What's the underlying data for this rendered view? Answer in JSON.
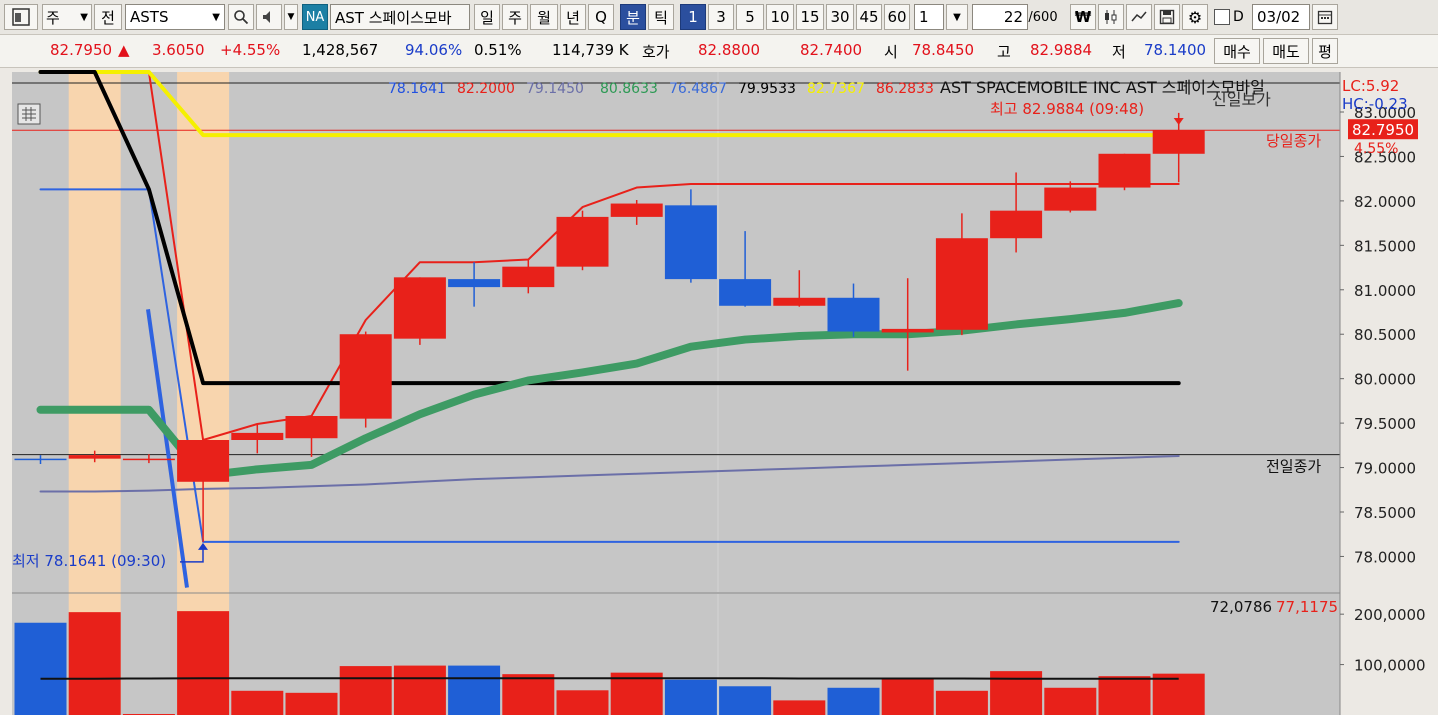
{
  "toolbar": {
    "type_label": "주",
    "prev_label": "전",
    "symbol": "ASTS",
    "badge": "NA",
    "name": "AST 스페이스모바",
    "periods": [
      "일",
      "주",
      "월",
      "년",
      "Q",
      "분",
      "틱"
    ],
    "minutes": [
      "1",
      "3",
      "5",
      "10",
      "15",
      "30",
      "45",
      "60"
    ],
    "step_value": "1",
    "count_value": "22",
    "count_total": "/600",
    "date_check_label": "D",
    "date_value": "03/02"
  },
  "quote": {
    "price": "82.7950",
    "arrow": "▲",
    "change": "3.6050",
    "change_pct": "+4.55%",
    "volume": "1,428,567",
    "vol_ratio": "94.06%",
    "turnover_pct": "0.51%",
    "amount": "114,739 K",
    "hoga_label": "호가",
    "ask": "82.8800",
    "bid": "82.7400",
    "open_label": "시",
    "open": "78.8450",
    "high_label": "고",
    "high": "82.9884",
    "low_label": "저",
    "low": "78.1400",
    "buy_label": "매수",
    "sell_label": "매도",
    "flat_label": "평"
  },
  "colors": {
    "up": "#e8211a",
    "down": "#1f5fd6",
    "ma_green": "#3e9b64",
    "ma_yellow": "#f5f000",
    "plot_bg": "#c6c6c6",
    "highlight": "#f8d5ae"
  },
  "chart_data": {
    "type": "candlestick",
    "legend": {
      "values": [
        "78.1641",
        "82.2000",
        "79.1450",
        "80.8633",
        "76.4867",
        "79.9533",
        "82.7367",
        "86.2833"
      ],
      "colors": [
        "#2151e0",
        "#e8211a",
        "#6b6fa8",
        "#2e9a55",
        "#3a6ad8",
        "#000000",
        "#f5f000",
        "#e8211a"
      ],
      "title": "AST SPACEMOBILE INC  AST 스페이스모바일"
    },
    "lc_label": "LC:5.92",
    "hc_label": "HC:-0.23",
    "price_tag": "82.7950",
    "price_tag_pct": "4.55%",
    "high_annotation": "최고 82.9884 (09:48)",
    "low_annotation": "최저 78.1641 (09:30)",
    "today_close_label": "당일종가",
    "prev_close_label": "전일종가",
    "top_cut_label": "신일보가",
    "y_axis": {
      "ylim": [
        77.6,
        83.45
      ],
      "ticks": [
        "78.0000",
        "78.5000",
        "79.0000",
        "79.5000",
        "80.0000",
        "80.5000",
        "81.0000",
        "81.5000",
        "82.0000",
        "82.5000",
        "83.0000"
      ],
      "tick_values": [
        78.0,
        78.5,
        79.0,
        79.5,
        80.0,
        80.5,
        81.0,
        81.5,
        82.0,
        82.5,
        83.0
      ]
    },
    "candles": [
      {
        "o": 79.1,
        "h": 79.14,
        "l": 79.04,
        "c": 79.09,
        "v": 183000
      },
      {
        "o": 79.1,
        "h": 79.19,
        "l": 79.06,
        "c": 79.14,
        "v": 204000
      },
      {
        "o": 79.1,
        "h": 79.15,
        "l": 79.05,
        "c": 79.1,
        "v": 2000
      },
      {
        "o": 78.84,
        "h": 79.32,
        "l": 78.164,
        "c": 79.31,
        "v": 206000
      },
      {
        "o": 79.31,
        "h": 79.49,
        "l": 79.16,
        "c": 79.39,
        "v": 48000
      },
      {
        "o": 79.33,
        "h": 79.58,
        "l": 79.12,
        "c": 79.58,
        "v": 44000
      },
      {
        "o": 79.55,
        "h": 80.53,
        "l": 79.45,
        "c": 80.5,
        "v": 97000
      },
      {
        "o": 80.45,
        "h": 81.14,
        "l": 80.38,
        "c": 81.14,
        "v": 98000
      },
      {
        "o": 81.12,
        "h": 81.31,
        "l": 80.81,
        "c": 81.03,
        "v": 98000
      },
      {
        "o": 81.03,
        "h": 81.34,
        "l": 80.96,
        "c": 81.26,
        "v": 81000
      },
      {
        "o": 81.26,
        "h": 81.89,
        "l": 81.22,
        "c": 81.82,
        "v": 49000
      },
      {
        "o": 81.82,
        "h": 82.01,
        "l": 81.73,
        "c": 81.97,
        "v": 84000
      },
      {
        "o": 81.95,
        "h": 82.13,
        "l": 81.08,
        "c": 81.12,
        "v": 70000
      },
      {
        "o": 81.12,
        "h": 81.66,
        "l": 80.81,
        "c": 80.82,
        "v": 57000
      },
      {
        "o": 80.82,
        "h": 81.22,
        "l": 80.81,
        "c": 80.91,
        "v": 29000
      },
      {
        "o": 80.91,
        "h": 81.07,
        "l": 80.47,
        "c": 80.53,
        "v": 54000
      },
      {
        "o": 80.52,
        "h": 81.13,
        "l": 80.09,
        "c": 80.56,
        "v": 72000
      },
      {
        "o": 80.55,
        "h": 81.86,
        "l": 80.49,
        "c": 81.58,
        "v": 48000
      },
      {
        "o": 81.58,
        "h": 82.32,
        "l": 81.42,
        "c": 81.89,
        "v": 87000
      },
      {
        "o": 81.89,
        "h": 82.22,
        "l": 81.87,
        "c": 82.15,
        "v": 54000
      },
      {
        "o": 82.15,
        "h": 82.53,
        "l": 82.12,
        "c": 82.53,
        "v": 77000
      },
      {
        "o": 82.53,
        "h": 82.99,
        "l": 82.21,
        "c": 82.795,
        "v": 82000
      }
    ],
    "ma_green": [
      79.65,
      79.65,
      79.65,
      78.91,
      78.98,
      79.03,
      79.33,
      79.6,
      79.82,
      79.98,
      80.07,
      80.17,
      80.36,
      80.44,
      80.48,
      80.5,
      80.5,
      80.54,
      80.61,
      80.67,
      80.74,
      80.85
    ],
    "ma_purple": [
      78.73,
      78.73,
      78.74,
      78.76,
      78.77,
      78.79,
      78.81,
      78.84,
      78.87,
      78.89,
      78.91,
      78.93,
      78.95,
      78.97,
      78.99,
      79.01,
      79.03,
      79.05,
      79.07,
      79.09,
      79.11,
      79.13
    ],
    "red_upper": [
      83.45,
      83.45,
      83.45,
      79.31,
      79.49,
      79.58,
      80.66,
      81.31,
      81.31,
      81.34,
      81.93,
      82.15,
      82.19,
      82.19,
      82.19,
      82.19,
      82.19,
      82.19,
      82.19,
      82.19,
      82.19,
      82.19
    ],
    "blue_lower": [
      82.13,
      82.13,
      82.13,
      78.164,
      78.164,
      78.164,
      78.164,
      78.164,
      78.164,
      78.164,
      78.164,
      78.164,
      78.164,
      78.164,
      78.164,
      78.164,
      78.164,
      78.164,
      78.164,
      78.164,
      78.164,
      78.164
    ],
    "black_line": [
      83.45,
      83.45,
      82.13,
      79.95,
      79.95,
      79.95,
      79.95,
      79.95,
      79.95,
      79.95,
      79.95,
      79.95,
      79.95,
      79.95,
      79.95,
      79.95,
      79.95,
      79.95,
      79.95,
      79.95,
      79.95,
      79.95
    ],
    "yellow_line": [
      83.45,
      83.45,
      83.45,
      82.74,
      82.74,
      82.74,
      82.74,
      82.74,
      82.74,
      82.74,
      82.74,
      82.74,
      82.74,
      82.74,
      82.74,
      82.74,
      82.74,
      82.74,
      82.74,
      82.74,
      82.74,
      82.74
    ],
    "prev_close": 79.145,
    "today_close": 82.795,
    "highlight_bars": [
      1,
      3
    ],
    "volume": {
      "ylim": [
        0,
        240000
      ],
      "ticks": [
        "100,0000",
        "200,0000"
      ],
      "tick_values": [
        100000,
        200000
      ],
      "legend_values": [
        "72,0786",
        "77,1175"
      ],
      "avg": [
        72000,
        72000,
        72500,
        73000,
        73000,
        73000,
        73000,
        73000,
        73000,
        73000,
        73000,
        73000,
        73000,
        73000,
        72500,
        72500,
        72500,
        72500,
        72000,
        72000,
        72000,
        72000
      ]
    }
  }
}
